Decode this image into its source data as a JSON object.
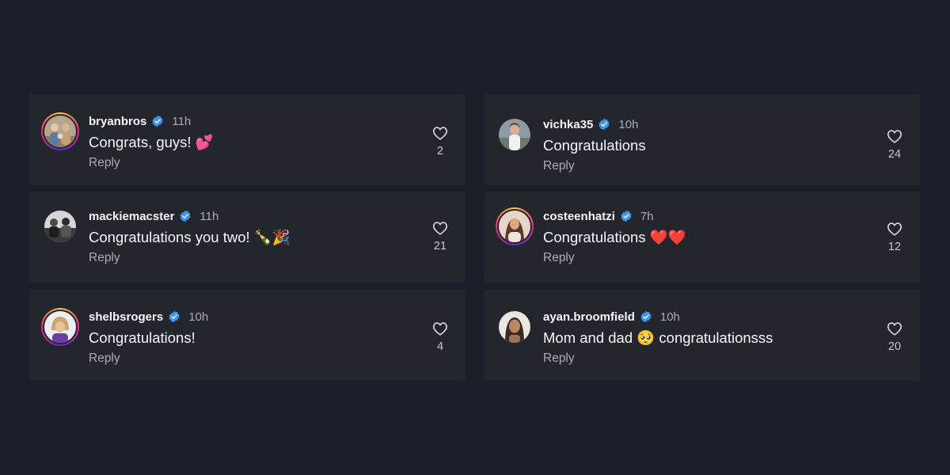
{
  "colors": {
    "background": "#1b1f29",
    "card": "#23272d",
    "verified": "#3b97f0",
    "muted": "#a8adb6"
  },
  "reply_label": "Reply",
  "comments": [
    {
      "username": "bryanbros",
      "time": "11h",
      "text": "Congrats, guys! 💕",
      "likes": "2",
      "story_ring": true,
      "avatar_icon": "group-photo-avatar"
    },
    {
      "username": "vichka35",
      "time": "10h",
      "text": "Congratulations",
      "likes": "24",
      "story_ring": false,
      "avatar_icon": "person-avatar"
    },
    {
      "username": "mackiemacster",
      "time": "11h",
      "text": "Congratulations you two! 🍾🎉",
      "likes": "21",
      "story_ring": false,
      "avatar_icon": "group-photo-avatar"
    },
    {
      "username": "costeenhatzi",
      "time": "7h",
      "text": "Congratulations ❤️❤️",
      "likes": "12",
      "story_ring": true,
      "avatar_icon": "person-avatar"
    },
    {
      "username": "shelbsrogers",
      "time": "10h",
      "text": "Congratulations!",
      "likes": "4",
      "story_ring": true,
      "avatar_icon": "person-avatar"
    },
    {
      "username": "ayan.broomfield",
      "time": "10h",
      "text": "Mom and dad 🥺 congratulationsss",
      "likes": "20",
      "story_ring": false,
      "avatar_icon": "person-avatar"
    }
  ]
}
